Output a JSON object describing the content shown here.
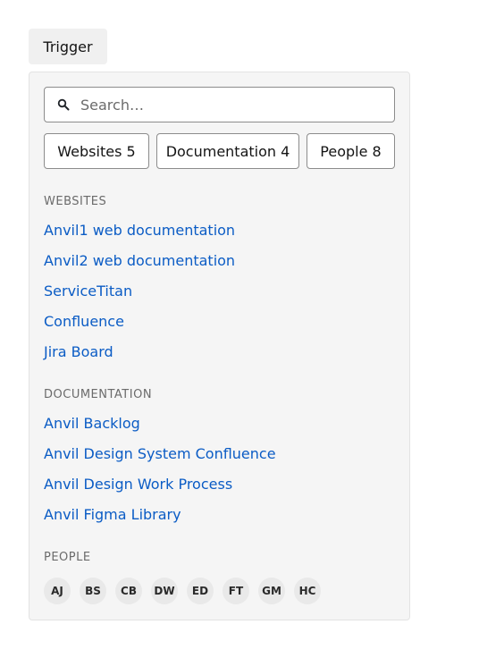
{
  "trigger": {
    "label": "Trigger"
  },
  "search": {
    "placeholder": "Search…"
  },
  "chips": [
    {
      "label": "Websites 5"
    },
    {
      "label": "Documentation 4"
    },
    {
      "label": "People 8"
    }
  ],
  "sections": {
    "websites": {
      "heading": "WEBSITES",
      "items": [
        "Anvil1 web documentation",
        "Anvil2 web documentation",
        "ServiceTitan",
        "Confluence",
        "Jira Board"
      ]
    },
    "documentation": {
      "heading": "DOCUMENTATION",
      "items": [
        "Anvil Backlog",
        "Anvil Design System Confluence",
        "Anvil Design Work Process",
        "Anvil Figma Library"
      ]
    },
    "people": {
      "heading": "PEOPLE",
      "avatars": [
        "AJ",
        "BS",
        "CB",
        "DW",
        "ED",
        "FT",
        "GM",
        "HC"
      ]
    }
  },
  "colors": {
    "link": "#0b5cc5",
    "popover_bg": "#f5f5f5",
    "trigger_bg": "#f0f0f0",
    "avatar_bg": "#e9e9e9"
  },
  "icons": {
    "search": "search-icon"
  }
}
